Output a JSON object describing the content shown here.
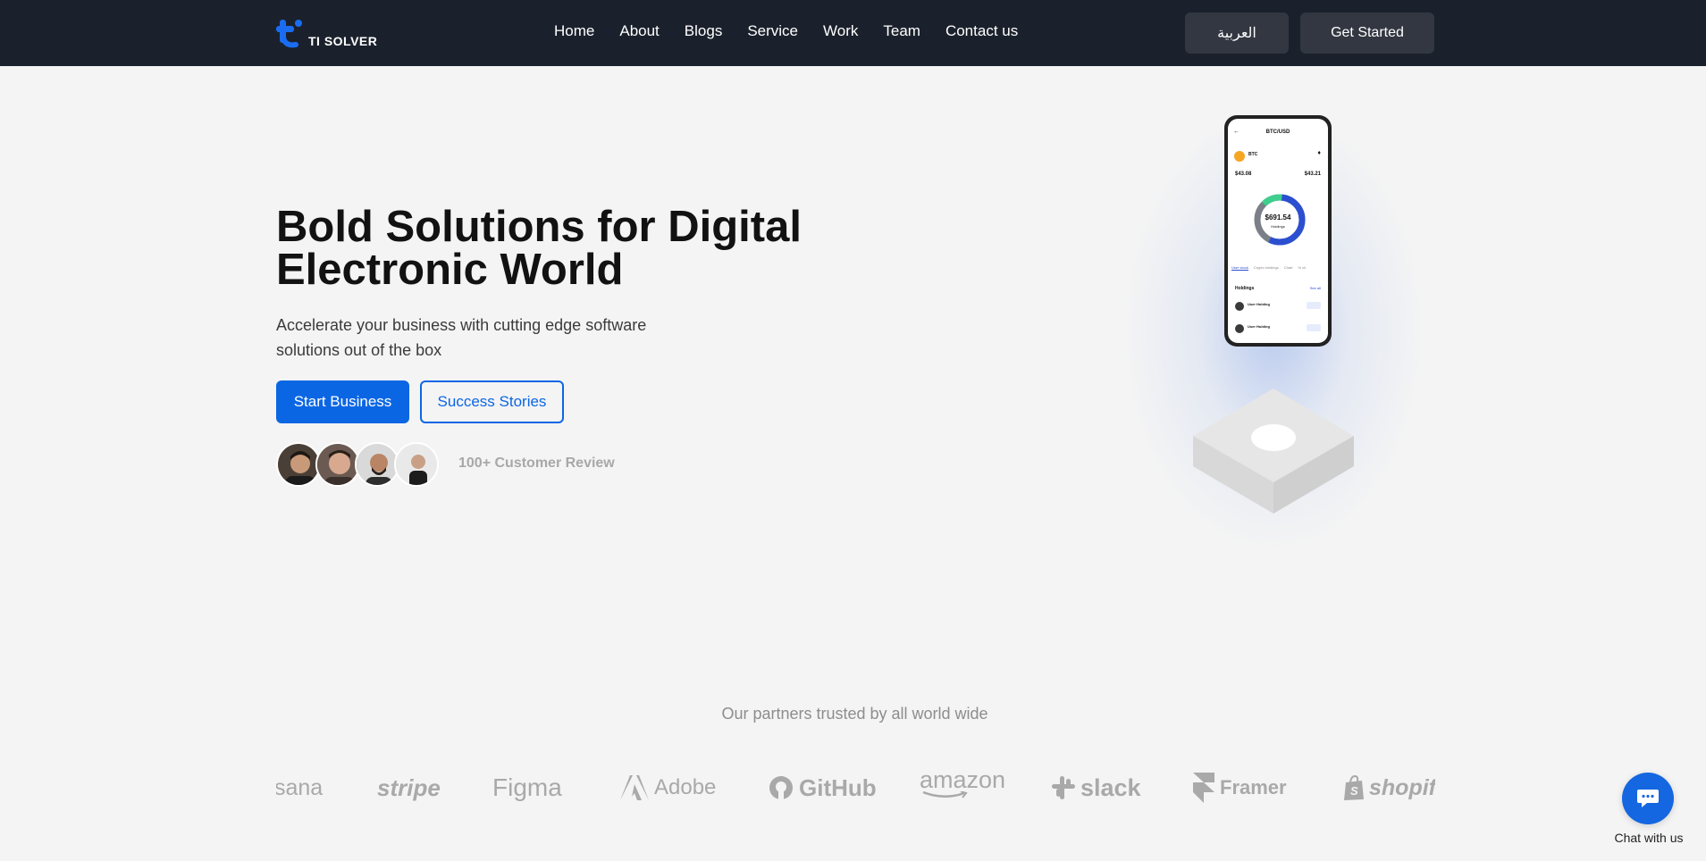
{
  "brand": {
    "name": "TI SOLVER",
    "accent": "#0b66e4"
  },
  "nav": {
    "items": [
      "Home",
      "About",
      "Blogs",
      "Service",
      "Work",
      "Team",
      "Contact us"
    ],
    "lang_label": "العربية",
    "cta_label": "Get Started"
  },
  "hero": {
    "title": "Bold Solutions for Digital Electronic World",
    "subtitle": "Accelerate your business with cutting edge software solutions out of the box",
    "primary_label": "Start Business",
    "secondary_label": "Success Stories",
    "review_text": "100+ Customer Review"
  },
  "phone": {
    "title": "BTC/USD",
    "coin": "BTC",
    "price_left": "$43.08",
    "price_right": "$43.21",
    "total": "$691.54",
    "total_label": "Holdings",
    "tabs": [
      "User stock",
      "Crypto holdings",
      "Chart",
      "% ch"
    ],
    "holdings_label": "Holdings",
    "see_all": "See all",
    "rows": [
      "User Holding",
      "User Holding"
    ]
  },
  "partners": {
    "title": "Our partners trusted by all world wide",
    "items": [
      "sana",
      "stripe",
      "Figma",
      "Adobe",
      "GitHub",
      "amazon",
      "slack",
      "Framer",
      "shopify"
    ]
  },
  "chat": {
    "label": "Chat with us"
  }
}
